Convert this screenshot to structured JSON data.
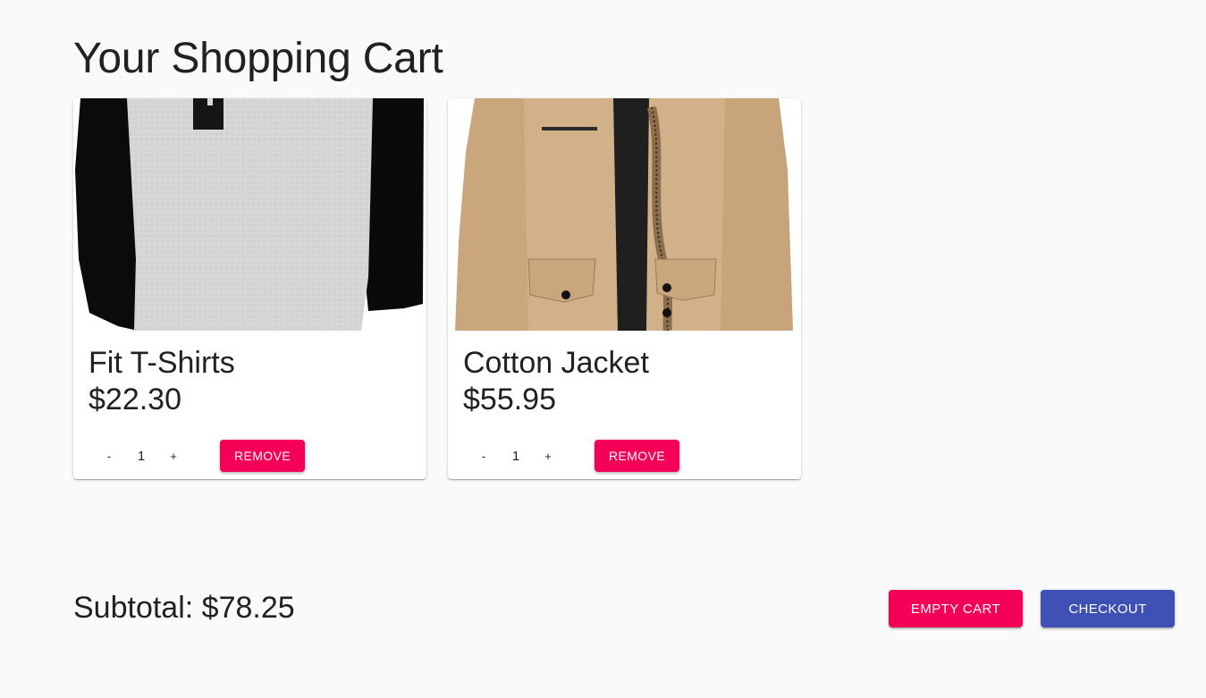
{
  "page": {
    "title": "Your Shopping Cart"
  },
  "items": [
    {
      "name": "Fit T-Shirts",
      "price": "$22.30",
      "quantity": "1",
      "decrement_label": "-",
      "increment_label": "+",
      "remove_label": "REMOVE",
      "image_icon": "tshirt-image"
    },
    {
      "name": "Cotton Jacket",
      "price": "$55.95",
      "quantity": "1",
      "decrement_label": "-",
      "increment_label": "+",
      "remove_label": "REMOVE",
      "image_icon": "jacket-image"
    }
  ],
  "summary": {
    "subtotal_text": "Subtotal: $78.25"
  },
  "actions": {
    "empty_cart_label": "EMPTY CART",
    "checkout_label": "CHECKOUT"
  },
  "colors": {
    "secondary": "#f50057",
    "primary": "#3f51b5",
    "background": "#fafafa"
  }
}
